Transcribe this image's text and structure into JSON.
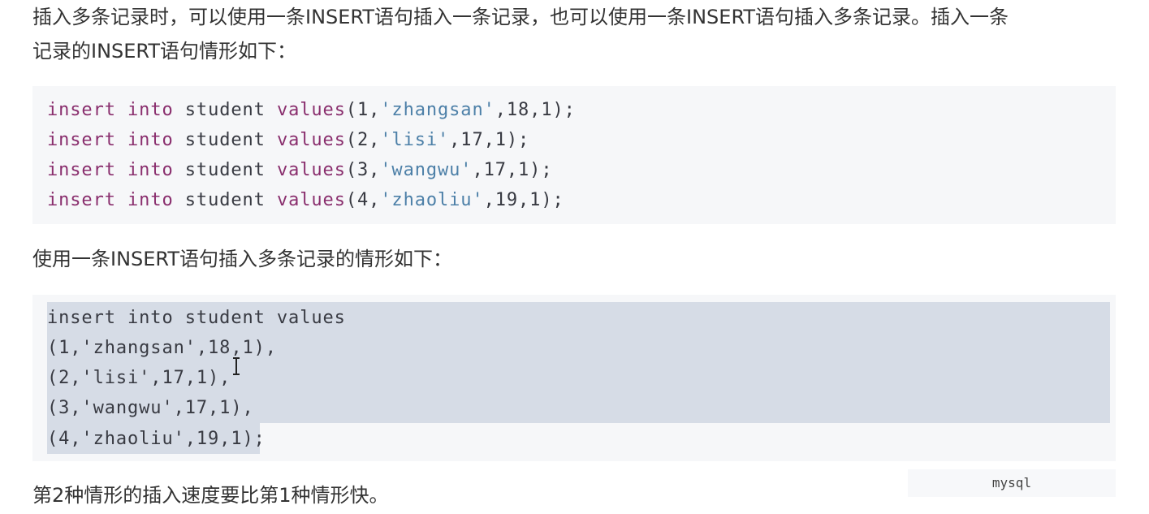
{
  "paragraphs": {
    "intro": "插入多条记录时，可以使用一条INSERT语句插入一条记录，也可以使用一条INSERT语句插入多条记录。插入一条",
    "intro_cont": "记录的INSERT语句情形如下：",
    "multi": "使用一条INSERT语句插入多条记录的情形如下：",
    "conclusion": "第2种情形的插入速度要比第1种情形快。"
  },
  "code_block_1": {
    "lines": [
      {
        "kw1": "insert",
        "kw2": "into",
        "table": "student",
        "kw3": "values",
        "open": "(1,",
        "str": "'zhangsan'",
        "close": ",18,1);"
      },
      {
        "kw1": "insert",
        "kw2": "into",
        "table": "student",
        "kw3": "values",
        "open": "(2,",
        "str": "'lisi'",
        "close": ",17,1);"
      },
      {
        "kw1": "insert",
        "kw2": "into",
        "table": "student",
        "kw3": "values",
        "open": "(3,",
        "str": "'wangwu'",
        "close": ",17,1);"
      },
      {
        "kw1": "insert",
        "kw2": "into",
        "table": "student",
        "kw3": "values",
        "open": "(4,",
        "str": "'zhaoliu'",
        "close": ",19,1);"
      }
    ]
  },
  "code_block_2": {
    "lines": [
      "insert into student values",
      "(1,'zhangsan',18,1),",
      "(2,'lisi',17,1),",
      "(3,'wangwu',17,1),",
      "(4,'zhaoliu',19,1);"
    ],
    "language": "mysql"
  },
  "colors": {
    "keyword": "#8a2f6e",
    "string": "#4d80a8",
    "code_bg": "#f6f7f9",
    "selection": "#d6dce6"
  },
  "icons": {
    "cursor": "text-cursor-icon"
  }
}
